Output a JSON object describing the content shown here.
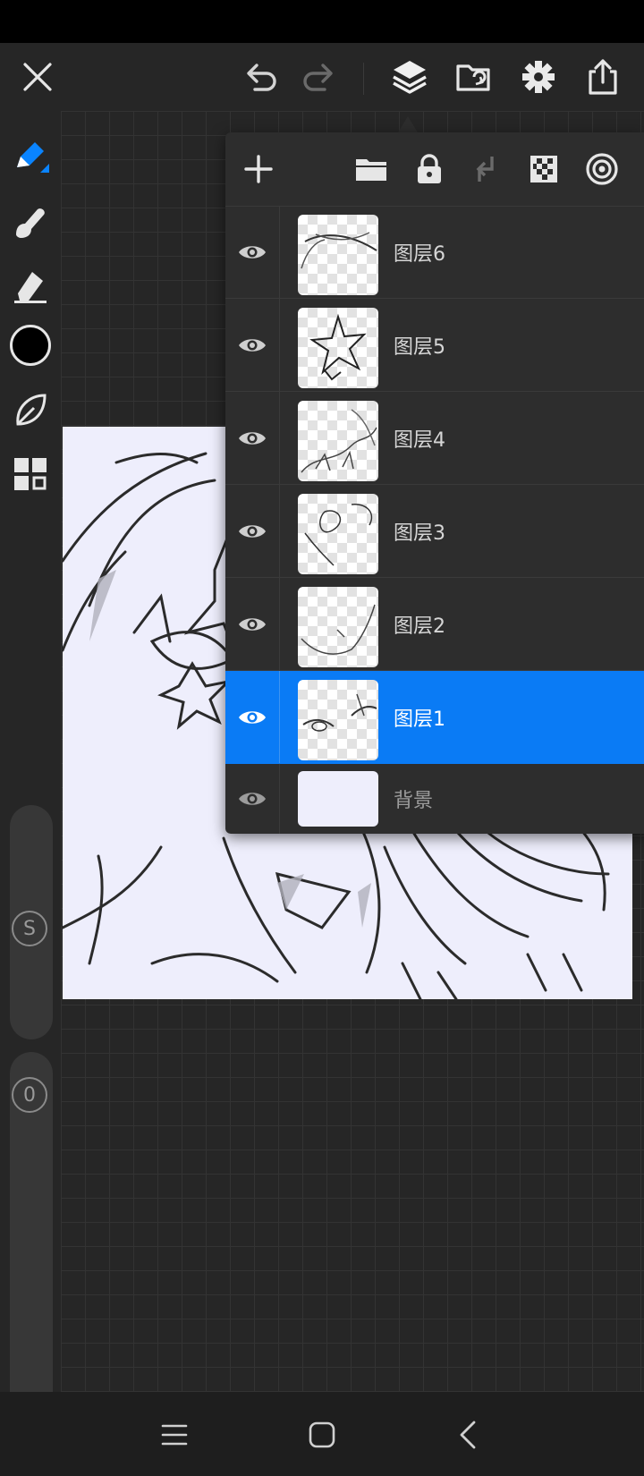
{
  "toolbar": {
    "icons": [
      "close-icon",
      "undo-icon",
      "redo-icon",
      "layers-icon",
      "import-icon",
      "settings-icon",
      "share-icon"
    ]
  },
  "left_tools": {
    "icons": [
      "pen-icon",
      "smudge-icon",
      "eraser-icon",
      "color-swatch",
      "leaf-brush-icon",
      "grid-icon"
    ],
    "active_color": "#000000",
    "accent": "#0a84ff"
  },
  "sliders": {
    "size_label": "S",
    "opacity_label": "0"
  },
  "layers_panel": {
    "toolbar_icons": [
      "add-layer-icon",
      "folder-icon",
      "lock-icon",
      "merge-down-icon",
      "transparency-icon",
      "blend-icon"
    ],
    "layers": [
      {
        "name": "图层6",
        "visible": true,
        "selected": false
      },
      {
        "name": "图层5",
        "visible": true,
        "selected": false
      },
      {
        "name": "图层4",
        "visible": true,
        "selected": false
      },
      {
        "name": "图层3",
        "visible": true,
        "selected": false
      },
      {
        "name": "图层2",
        "visible": true,
        "selected": false
      },
      {
        "name": "图层1",
        "visible": true,
        "selected": true
      },
      {
        "name": "背景",
        "visible": true,
        "selected": false
      }
    ],
    "selected_color": "#0a7bf5"
  },
  "nav": {
    "icons": [
      "recent-apps-icon",
      "home-icon",
      "back-icon"
    ]
  }
}
